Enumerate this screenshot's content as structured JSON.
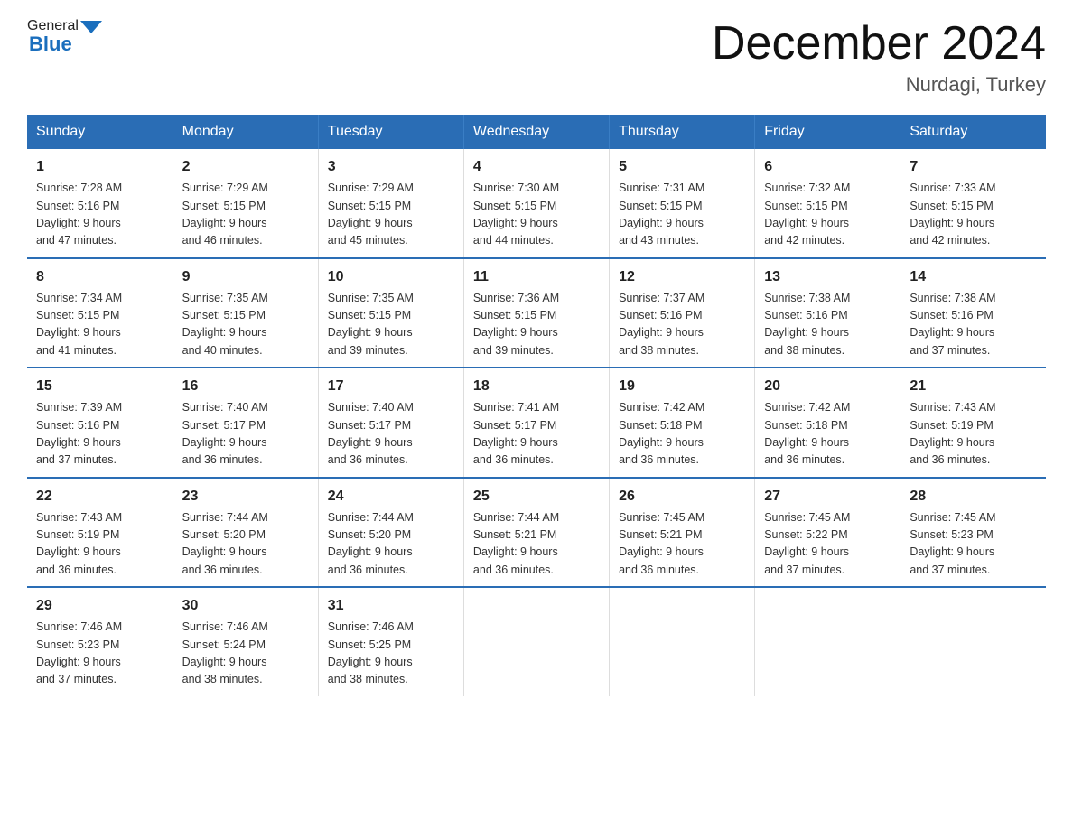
{
  "header": {
    "logo_general": "General",
    "logo_blue": "Blue",
    "month_title": "December 2024",
    "location": "Nurdagi, Turkey"
  },
  "days_of_week": [
    "Sunday",
    "Monday",
    "Tuesday",
    "Wednesday",
    "Thursday",
    "Friday",
    "Saturday"
  ],
  "weeks": [
    [
      {
        "day": "1",
        "sunrise": "7:28 AM",
        "sunset": "5:16 PM",
        "daylight": "9 hours and 47 minutes."
      },
      {
        "day": "2",
        "sunrise": "7:29 AM",
        "sunset": "5:15 PM",
        "daylight": "9 hours and 46 minutes."
      },
      {
        "day": "3",
        "sunrise": "7:29 AM",
        "sunset": "5:15 PM",
        "daylight": "9 hours and 45 minutes."
      },
      {
        "day": "4",
        "sunrise": "7:30 AM",
        "sunset": "5:15 PM",
        "daylight": "9 hours and 44 minutes."
      },
      {
        "day": "5",
        "sunrise": "7:31 AM",
        "sunset": "5:15 PM",
        "daylight": "9 hours and 43 minutes."
      },
      {
        "day": "6",
        "sunrise": "7:32 AM",
        "sunset": "5:15 PM",
        "daylight": "9 hours and 42 minutes."
      },
      {
        "day": "7",
        "sunrise": "7:33 AM",
        "sunset": "5:15 PM",
        "daylight": "9 hours and 42 minutes."
      }
    ],
    [
      {
        "day": "8",
        "sunrise": "7:34 AM",
        "sunset": "5:15 PM",
        "daylight": "9 hours and 41 minutes."
      },
      {
        "day": "9",
        "sunrise": "7:35 AM",
        "sunset": "5:15 PM",
        "daylight": "9 hours and 40 minutes."
      },
      {
        "day": "10",
        "sunrise": "7:35 AM",
        "sunset": "5:15 PM",
        "daylight": "9 hours and 39 minutes."
      },
      {
        "day": "11",
        "sunrise": "7:36 AM",
        "sunset": "5:15 PM",
        "daylight": "9 hours and 39 minutes."
      },
      {
        "day": "12",
        "sunrise": "7:37 AM",
        "sunset": "5:16 PM",
        "daylight": "9 hours and 38 minutes."
      },
      {
        "day": "13",
        "sunrise": "7:38 AM",
        "sunset": "5:16 PM",
        "daylight": "9 hours and 38 minutes."
      },
      {
        "day": "14",
        "sunrise": "7:38 AM",
        "sunset": "5:16 PM",
        "daylight": "9 hours and 37 minutes."
      }
    ],
    [
      {
        "day": "15",
        "sunrise": "7:39 AM",
        "sunset": "5:16 PM",
        "daylight": "9 hours and 37 minutes."
      },
      {
        "day": "16",
        "sunrise": "7:40 AM",
        "sunset": "5:17 PM",
        "daylight": "9 hours and 36 minutes."
      },
      {
        "day": "17",
        "sunrise": "7:40 AM",
        "sunset": "5:17 PM",
        "daylight": "9 hours and 36 minutes."
      },
      {
        "day": "18",
        "sunrise": "7:41 AM",
        "sunset": "5:17 PM",
        "daylight": "9 hours and 36 minutes."
      },
      {
        "day": "19",
        "sunrise": "7:42 AM",
        "sunset": "5:18 PM",
        "daylight": "9 hours and 36 minutes."
      },
      {
        "day": "20",
        "sunrise": "7:42 AM",
        "sunset": "5:18 PM",
        "daylight": "9 hours and 36 minutes."
      },
      {
        "day": "21",
        "sunrise": "7:43 AM",
        "sunset": "5:19 PM",
        "daylight": "9 hours and 36 minutes."
      }
    ],
    [
      {
        "day": "22",
        "sunrise": "7:43 AM",
        "sunset": "5:19 PM",
        "daylight": "9 hours and 36 minutes."
      },
      {
        "day": "23",
        "sunrise": "7:44 AM",
        "sunset": "5:20 PM",
        "daylight": "9 hours and 36 minutes."
      },
      {
        "day": "24",
        "sunrise": "7:44 AM",
        "sunset": "5:20 PM",
        "daylight": "9 hours and 36 minutes."
      },
      {
        "day": "25",
        "sunrise": "7:44 AM",
        "sunset": "5:21 PM",
        "daylight": "9 hours and 36 minutes."
      },
      {
        "day": "26",
        "sunrise": "7:45 AM",
        "sunset": "5:21 PM",
        "daylight": "9 hours and 36 minutes."
      },
      {
        "day": "27",
        "sunrise": "7:45 AM",
        "sunset": "5:22 PM",
        "daylight": "9 hours and 37 minutes."
      },
      {
        "day": "28",
        "sunrise": "7:45 AM",
        "sunset": "5:23 PM",
        "daylight": "9 hours and 37 minutes."
      }
    ],
    [
      {
        "day": "29",
        "sunrise": "7:46 AM",
        "sunset": "5:23 PM",
        "daylight": "9 hours and 37 minutes."
      },
      {
        "day": "30",
        "sunrise": "7:46 AM",
        "sunset": "5:24 PM",
        "daylight": "9 hours and 38 minutes."
      },
      {
        "day": "31",
        "sunrise": "7:46 AM",
        "sunset": "5:25 PM",
        "daylight": "9 hours and 38 minutes."
      },
      null,
      null,
      null,
      null
    ]
  ],
  "labels": {
    "sunrise_prefix": "Sunrise: ",
    "sunset_prefix": "Sunset: ",
    "daylight_prefix": "Daylight: "
  }
}
